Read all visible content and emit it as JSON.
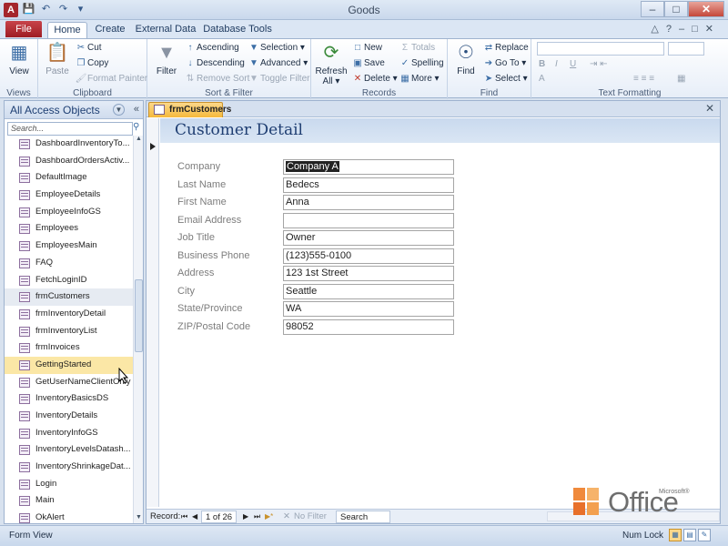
{
  "window": {
    "title": "Goods",
    "app_icon_letter": "A",
    "minimize": "–",
    "maximize": "□",
    "close": "✕"
  },
  "ribbon_tabs": [
    "File",
    "Home",
    "Create",
    "External Data",
    "Database Tools"
  ],
  "ribbon": {
    "views": {
      "view": "View",
      "label": "Views"
    },
    "clipboard": {
      "paste": "Paste",
      "cut": "Cut",
      "copy": "Copy",
      "format_painter": "Format Painter",
      "label": "Clipboard"
    },
    "sort_filter": {
      "filter": "Filter",
      "ascending": "Ascending",
      "descending": "Descending",
      "remove_sort": "Remove Sort",
      "selection": "Selection ▾",
      "advanced": "Advanced ▾",
      "toggle_filter": "Toggle Filter",
      "label": "Sort & Filter"
    },
    "records": {
      "refresh": "Refresh",
      "refresh_all": "All ▾",
      "new": "New",
      "save": "Save",
      "delete": "Delete ▾",
      "totals": "Totals",
      "spelling": "Spelling",
      "more": "More ▾",
      "label": "Records"
    },
    "find": {
      "find": "Find",
      "replace": "Replace",
      "goto": "Go To ▾",
      "select": "Select ▾",
      "label": "Find"
    },
    "text_formatting": {
      "bold": "B",
      "italic": "I",
      "underline": "U",
      "font_color": "A",
      "label": "Text Formatting"
    }
  },
  "nav_pane": {
    "title": "All Access Objects",
    "search_placeholder": "Search...",
    "items": [
      "DashboardInventoryTo...",
      "DashboardOrdersActiv...",
      "DefaultImage",
      "EmployeeDetails",
      "EmployeeInfoGS",
      "Employees",
      "EmployeesMain",
      "FAQ",
      "FetchLoginID",
      "frmCustomers",
      "frmInventoryDetail",
      "frmInventoryList",
      "frmInvoices",
      "GettingStarted",
      "GetUserNameClientOnly",
      "InventoryBasicsDS",
      "InventoryDetails",
      "InventoryInfoGS",
      "InventoryLevelsDatash...",
      "InventoryShrinkageDat...",
      "Login",
      "Main",
      "OkAlert"
    ],
    "selected_index": 9,
    "hover_index": 13
  },
  "document": {
    "tab_label": "frmCustomers",
    "form_title": "Customer Detail",
    "fields": [
      {
        "label": "Company",
        "value": "Company A",
        "selected": true
      },
      {
        "label": "Last Name",
        "value": "Bedecs"
      },
      {
        "label": "First Name",
        "value": "Anna"
      },
      {
        "label": "Email Address",
        "value": ""
      },
      {
        "label": "Job Title",
        "value": "Owner"
      },
      {
        "label": "Business Phone",
        "value": "(123)555-0100"
      },
      {
        "label": "Address",
        "value": "123 1st Street"
      },
      {
        "label": "City",
        "value": "Seattle"
      },
      {
        "label": "State/Province",
        "value": "WA"
      },
      {
        "label": "ZIP/Postal Code",
        "value": "98052"
      }
    ]
  },
  "record_nav": {
    "label": "Record:",
    "current": "1 of 26",
    "first": "⏮",
    "prev": "◀",
    "next": "▶",
    "last": "⏭",
    "new": "▶*",
    "filter_status": "No Filter",
    "search": "Search"
  },
  "status": {
    "view": "Form View",
    "num_lock": "Num Lock"
  },
  "branding": {
    "office_text": "Office",
    "microsoft": "Microsoft®"
  },
  "colors": {
    "file_tab": "#a4262c",
    "doc_tab": "#f5b93c",
    "form_title": "#1f3e72",
    "logo_orange": "#e8702a"
  }
}
